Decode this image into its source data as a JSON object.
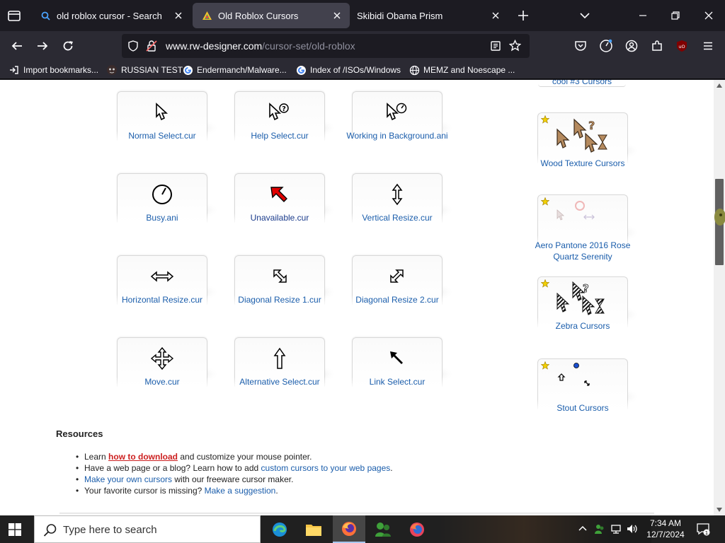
{
  "tabs": [
    {
      "title": "old roblox cursor - Search",
      "favicon": "search-icon",
      "active": false
    },
    {
      "title": "Old Roblox Cursors",
      "favicon": "rw-designer-icon",
      "active": true
    },
    {
      "title": "Skibidi Obama Prism",
      "favicon": "",
      "active": false
    }
  ],
  "address": {
    "host": "www.rw-designer.com",
    "path": "/cursor-set/old-roblox"
  },
  "bookmarks": [
    {
      "label": "Import bookmarks...",
      "icon": "import-icon"
    },
    {
      "label": "RUSSIAN TEST",
      "icon": "mask-icon"
    },
    {
      "label": "Endermanch/Malware...",
      "icon": "google-icon"
    },
    {
      "label": "Index of /ISOs/Windows",
      "icon": "google-icon"
    },
    {
      "label": "MEMZ and Noescape ...",
      "icon": "globe-icon"
    }
  ],
  "cursors": [
    {
      "label": "Normal Select.cur",
      "icon": "arrow-cursor-icon"
    },
    {
      "label": "Help Select.cur",
      "icon": "help-cursor-icon"
    },
    {
      "label": "Working in Background.ani",
      "icon": "working-cursor-icon"
    },
    {
      "label": "Busy.ani",
      "icon": "busy-cursor-icon"
    },
    {
      "label": "Unavailable.cur",
      "icon": "unavailable-cursor-icon"
    },
    {
      "label": "Vertical Resize.cur",
      "icon": "vertical-resize-icon"
    },
    {
      "label": "Horizontal Resize.cur",
      "icon": "horizontal-resize-icon"
    },
    {
      "label": "Diagonal Resize 1.cur",
      "icon": "diagonal-resize-1-icon"
    },
    {
      "label": "Diagonal Resize 2.cur",
      "icon": "diagonal-resize-2-icon"
    },
    {
      "label": "Move.cur",
      "icon": "move-cursor-icon"
    },
    {
      "label": "Alternative Select.cur",
      "icon": "up-arrow-cursor-icon"
    },
    {
      "label": "Link Select.cur",
      "icon": "link-select-cursor-icon"
    }
  ],
  "sidebar": {
    "partial_label": "cool #3 Cursors",
    "sets": [
      {
        "label": "Wood Texture Cursors",
        "icon": "wood-cursors-icon"
      },
      {
        "label": "Aero Pantone 2016 Rose Quartz Serenity",
        "icon": "pantone-cursors-icon"
      },
      {
        "label": "Zebra Cursors",
        "icon": "zebra-cursors-icon"
      },
      {
        "label": "Stout Cursors",
        "icon": "stout-cursors-icon"
      }
    ]
  },
  "resources": {
    "heading": "Resources",
    "items": [
      {
        "pre": "Learn ",
        "link": "how to download",
        "post": " and customize your mouse pointer."
      },
      {
        "pre": "Have a web page or a blog? Learn how to add ",
        "link": "custom cursors to your web pages",
        "post": "."
      },
      {
        "pre": "",
        "link": "Make your own cursors",
        "post": " with our freeware cursor maker."
      },
      {
        "pre": "Your favorite cursor is missing? ",
        "link": "Make a suggestion",
        "post": "."
      }
    ]
  },
  "taskbar": {
    "search_placeholder": "Type here to search",
    "time": "7:34 AM",
    "date": "12/7/2024",
    "notifications": "1",
    "apps": [
      "edge-icon",
      "file-explorer-icon",
      "firefox-icon",
      "messenger-icon",
      "firefox-dev-icon"
    ]
  },
  "colors": {
    "link": "#1a5dab",
    "accent_red": "#cc1f1f",
    "tab_active": "#42414d",
    "toolbar": "#2b2a33"
  }
}
